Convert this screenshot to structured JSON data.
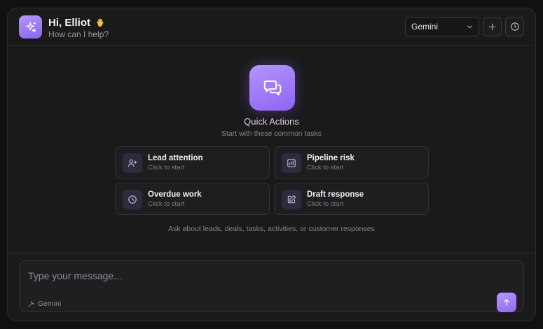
{
  "header": {
    "greeting": "Hi, Elliot",
    "greeting_emoji": "waving-hand-icon",
    "subtitle": "How can I help?",
    "model_select": {
      "value": "Gemini"
    },
    "new_chat_icon": "plus-icon",
    "history_icon": "clock-icon"
  },
  "quick_actions": {
    "title": "Quick Actions",
    "subtitle": "Start with these common tasks",
    "items": [
      {
        "title": "Lead attention",
        "subtitle": "Click to start",
        "icon": "user-plus-icon"
      },
      {
        "title": "Pipeline risk",
        "subtitle": "Click to start",
        "icon": "chart-icon"
      },
      {
        "title": "Overdue work",
        "subtitle": "Click to start",
        "icon": "clock-icon"
      },
      {
        "title": "Draft response",
        "subtitle": "Click to start",
        "icon": "edit-icon"
      }
    ],
    "hint": "Ask about leads, deals, tasks, activities, or customer responses"
  },
  "composer": {
    "placeholder": "Type your message...",
    "model_label": "Gemini",
    "send_icon": "arrow-up-icon"
  },
  "colors": {
    "accent": "#9d78f7",
    "background": "#1a1a1b",
    "card": "#1e1e20"
  }
}
